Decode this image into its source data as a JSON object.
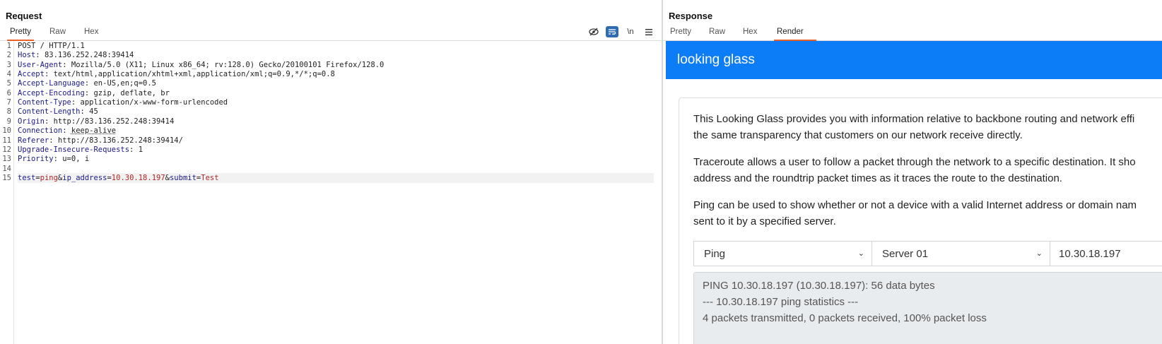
{
  "request": {
    "title": "Request",
    "tabs": [
      "Pretty",
      "Raw",
      "Hex"
    ],
    "active_tab": "Pretty",
    "toolbar": {
      "hide_icon": "eye-slash-icon",
      "wrap_icon": "word-wrap-icon",
      "newline_label": "\\n",
      "menu_icon": "hamburger-menu-icon"
    },
    "lines": [
      {
        "n": "1",
        "plain": "POST / HTTP/1.1"
      },
      {
        "n": "2",
        "name": "Host",
        "value": "83.136.252.248:39414"
      },
      {
        "n": "3",
        "name": "User-Agent",
        "value": "Mozilla/5.0 (X11; Linux x86_64; rv:128.0) Gecko/20100101 Firefox/128.0"
      },
      {
        "n": "4",
        "name": "Accept",
        "value": "text/html,application/xhtml+xml,application/xml;q=0.9,*/*;q=0.8"
      },
      {
        "n": "5",
        "name": "Accept-Language",
        "value": "en-US,en;q=0.5"
      },
      {
        "n": "6",
        "name": "Accept-Encoding",
        "value": "gzip, deflate, br"
      },
      {
        "n": "7",
        "name": "Content-Type",
        "value": "application/x-www-form-urlencoded"
      },
      {
        "n": "8",
        "name": "Content-Length",
        "value": "45"
      },
      {
        "n": "9",
        "name": "Origin",
        "value": "http://83.136.252.248:39414"
      },
      {
        "n": "10",
        "name": "Connection",
        "value": "keep-alive"
      },
      {
        "n": "11",
        "name": "Referer",
        "value": "http://83.136.252.248:39414/"
      },
      {
        "n": "12",
        "name": "Upgrade-Insecure-Requests",
        "value": "1"
      },
      {
        "n": "13",
        "name": "Priority",
        "value": "u=0, i"
      },
      {
        "n": "14",
        "plain": ""
      },
      {
        "n": "15",
        "params": [
          {
            "key": "test",
            "val": "ping"
          },
          {
            "key": "ip_address",
            "val": "10.30.18.197"
          },
          {
            "key": "submit",
            "val": "Test"
          }
        ]
      }
    ]
  },
  "response": {
    "title": "Response",
    "tabs": [
      "Pretty",
      "Raw",
      "Hex",
      "Render"
    ],
    "active_tab": "Render",
    "render": {
      "brand": "looking glass",
      "paragraphs": [
        [
          "This Looking Glass provides you with information relative to backbone routing and network effi",
          "the same transparency that customers on our network receive directly."
        ],
        [
          "Traceroute allows a user to follow a packet through the network to a specific destination. It sho",
          "address and the roundtrip packet times as it traces the route to the destination."
        ],
        [
          "Ping can be used to show whether or not a device with a valid Internet address or domain nam",
          "sent to it by a specified server."
        ]
      ],
      "test_select": "Ping",
      "server_select": "Server 01",
      "ip_input": "10.30.18.197",
      "output_lines": [
        "PING 10.30.18.197 (10.30.18.197): 56 data bytes",
        "--- 10.30.18.197 ping statistics ---",
        "4 packets transmitted, 0 packets received, 100% packet loss"
      ]
    }
  },
  "colors": {
    "accent_tab": "#e8602c",
    "brand_bar": "#0d7cf7",
    "header_name": "#1a1a8a",
    "param_value": "#b02525"
  }
}
